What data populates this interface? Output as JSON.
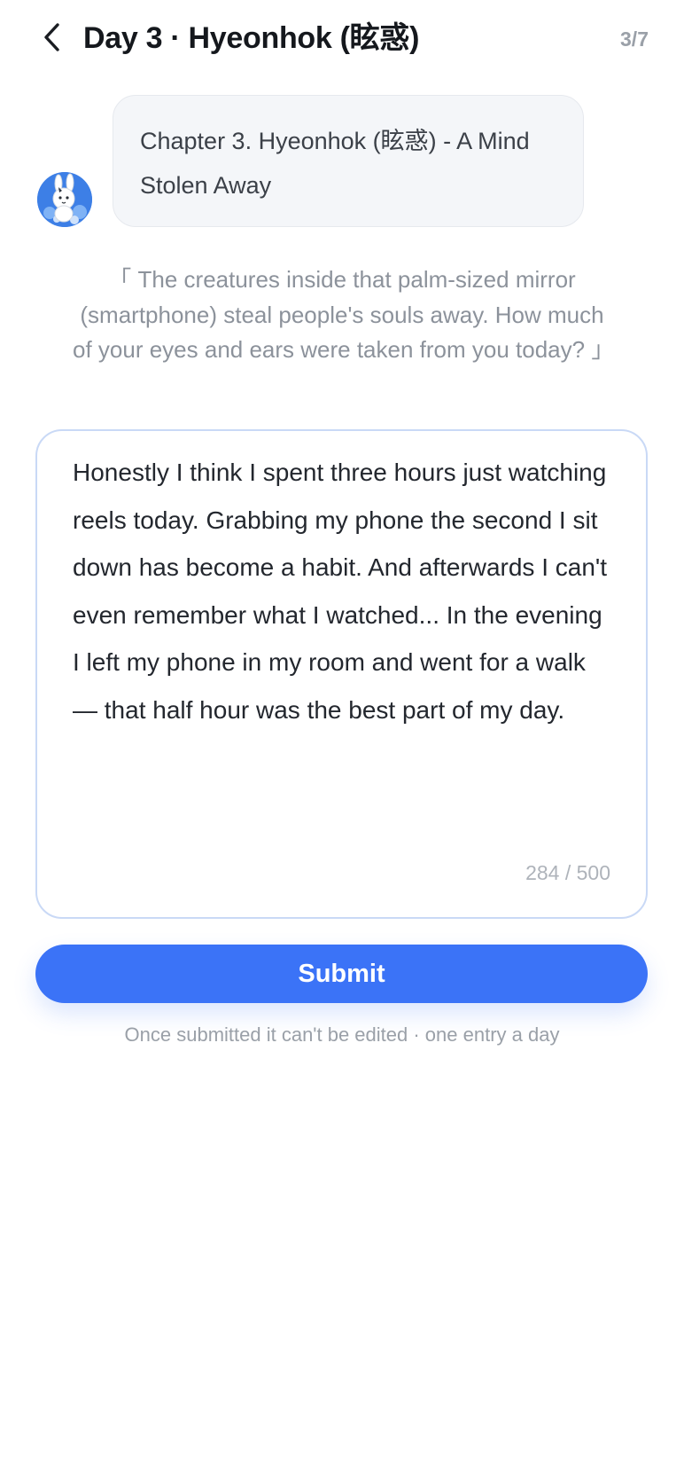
{
  "header": {
    "title": "Day 3 · Hyeonhok (眩惑)",
    "progress": "3/7",
    "back_icon": "chevron-left-icon"
  },
  "chat": {
    "avatar_icon": "bunny-avatar-icon",
    "bubble_text": "Chapter 3. Hyeonhok (眩惑) - A Mind Stolen Away"
  },
  "prompt": {
    "quote": "「 The creatures inside that palm-sized mirror (smartphone) steal people's souls away. How much of your eyes and ears were taken from you today? 」"
  },
  "entry": {
    "text": "Honestly I think I spent three hours just watching reels today. Grabbing my phone the second I sit down has become a habit. And afterwards I can't even remember what I watched... In the evening I left my phone in my room and went for a walk — that half hour was the best part of my day.",
    "char_count": "284 / 500"
  },
  "actions": {
    "submit_label": "Submit",
    "hint": "Once submitted it can't be edited · one entry a day"
  },
  "colors": {
    "accent": "#3b73f7",
    "card_border": "#c9d9f6",
    "muted_text": "#9aa0a8"
  }
}
